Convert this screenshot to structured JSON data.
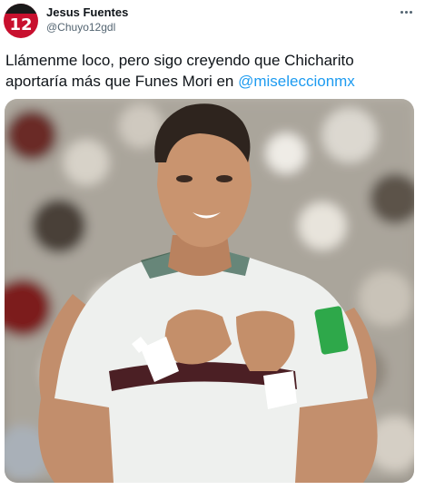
{
  "author": {
    "name": "Jesus Fuentes",
    "handle": "@Chuyo12gdl",
    "avatar_number": "12"
  },
  "tweet": {
    "text_before": "Llámenme loco, pero sigo creyendo que Chicharito aportaría más que Funes Mori en ",
    "mention": "@miseleccionmx"
  },
  "colors": {
    "link": "#1d9bf0",
    "secondary_text": "#536471",
    "avatar_red": "#c8102e"
  },
  "icons": {
    "more": "more-horizontal-icon"
  }
}
